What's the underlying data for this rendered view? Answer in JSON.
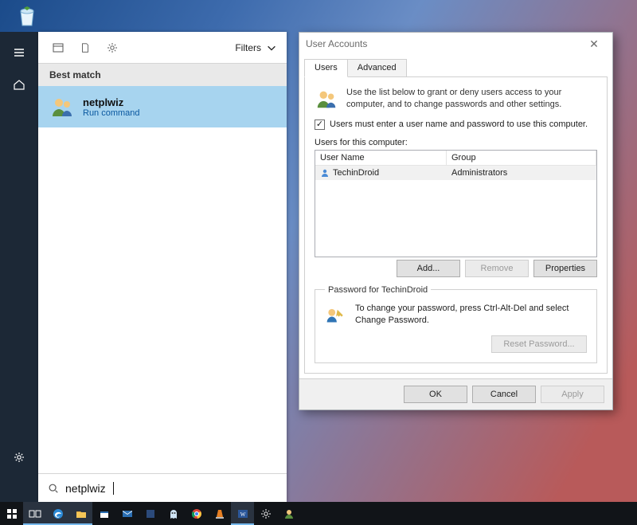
{
  "desktop": {
    "recycle_bin_name": "recycle-bin"
  },
  "start": {
    "filters_label": "Filters",
    "best_match_heading": "Best match",
    "result": {
      "title": "netplwiz",
      "subtitle": "Run command"
    },
    "search_value": "netplwiz"
  },
  "dialog": {
    "title": "User Accounts",
    "tabs": {
      "users": "Users",
      "advanced": "Advanced"
    },
    "intro": "Use the list below to grant or deny users access to your computer, and to change passwords and other settings.",
    "checkbox_label": "Users must enter a user name and password to use this computer.",
    "users_for_label": "Users for this computer:",
    "columns": {
      "username": "User Name",
      "group": "Group"
    },
    "row": {
      "username": "TechinDroid",
      "group": "Administrators"
    },
    "buttons": {
      "add": "Add...",
      "remove": "Remove",
      "properties": "Properties"
    },
    "password_group_label": "Password for TechinDroid",
    "password_text": "To change your password, press Ctrl-Alt-Del and select Change Password.",
    "reset_button": "Reset Password...",
    "ok": "OK",
    "cancel": "Cancel",
    "apply": "Apply"
  }
}
